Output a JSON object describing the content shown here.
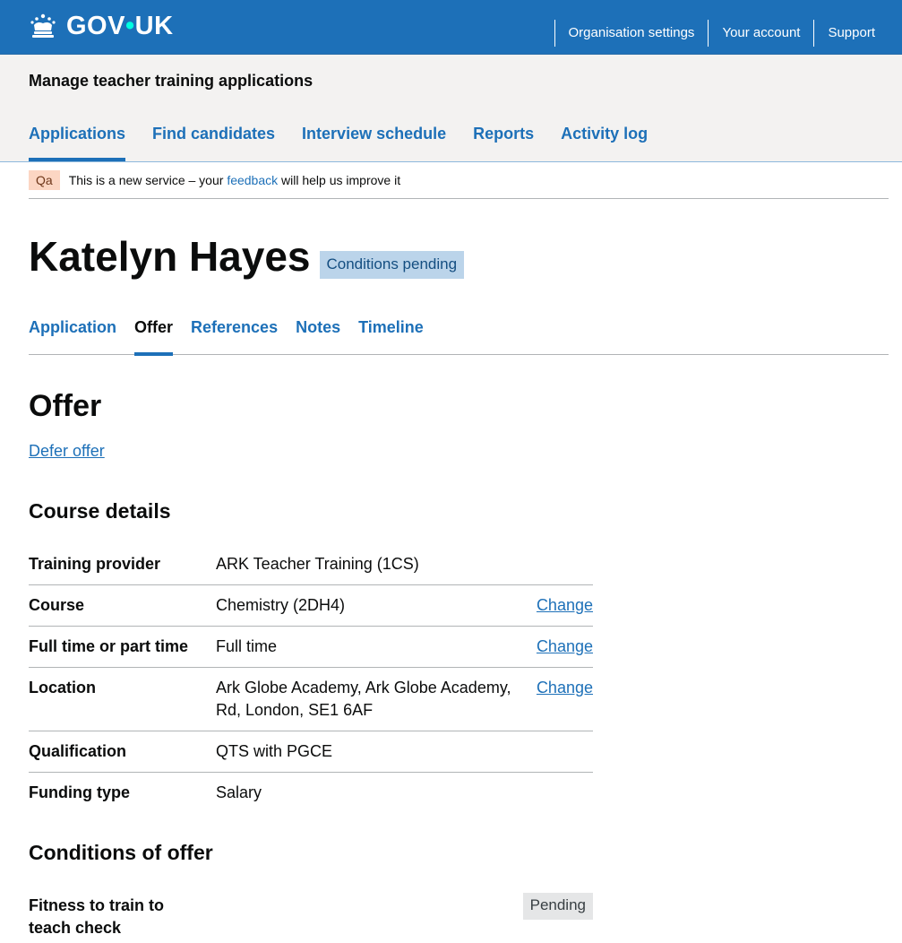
{
  "header": {
    "logo_text": "GOV",
    "logo_text_suffix": "UK",
    "links": [
      "Organisation settings",
      "Your account",
      "Support"
    ]
  },
  "service": {
    "name": "Manage teacher training applications",
    "nav": [
      "Applications",
      "Find candidates",
      "Interview schedule",
      "Reports",
      "Activity log"
    ],
    "active_nav": "Applications"
  },
  "phase_banner": {
    "tag": "Qa",
    "text_before": "This is a new service – your ",
    "link": "feedback",
    "text_after": " will help us improve it"
  },
  "candidate": {
    "name": "Katelyn Hayes",
    "status": "Conditions pending"
  },
  "sub_nav": [
    "Application",
    "Offer",
    "References",
    "Notes",
    "Timeline"
  ],
  "current_tab": "Offer",
  "offer": {
    "title": "Offer",
    "defer_link": "Defer offer",
    "course_details_title": "Course details",
    "rows": [
      {
        "key": "Training provider",
        "value": "ARK Teacher Training (1CS)",
        "action": ""
      },
      {
        "key": "Course",
        "value": "Chemistry (2DH4)",
        "action": "Change"
      },
      {
        "key": "Full time or part time",
        "value": "Full time",
        "action": "Change"
      },
      {
        "key": "Location",
        "value": "Ark Globe Academy, Ark Globe Academy, Rd, London, SE1 6AF",
        "action": "Change"
      },
      {
        "key": "Qualification",
        "value": "QTS with PGCE",
        "action": ""
      },
      {
        "key": "Funding type",
        "value": "Salary",
        "action": ""
      }
    ],
    "conditions_title": "Conditions of offer",
    "conditions": [
      {
        "key": "Fitness to train to teach check",
        "status": "Pending"
      }
    ]
  }
}
